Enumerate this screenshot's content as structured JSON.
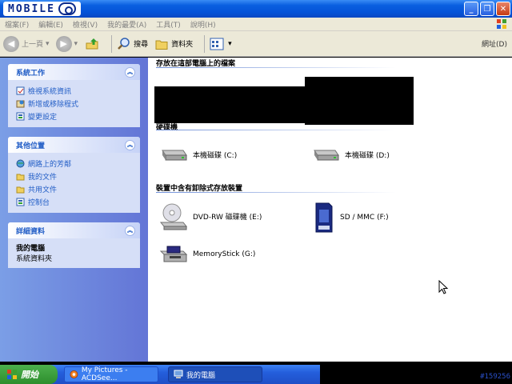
{
  "window": {
    "logo_text": "MOBILE"
  },
  "menu": [
    "檔案(F)",
    "編輯(E)",
    "檢視(V)",
    "我的最愛(A)",
    "工具(T)",
    "說明(H)"
  ],
  "toolbar": {
    "back_label": "上一頁",
    "search_label": "搜尋",
    "folders_label": "資料夾",
    "address_label": "網址(D)"
  },
  "left_panel": {
    "system_tasks": {
      "title": "系統工作",
      "items": [
        "檢視系統資訊",
        "新增或移除程式",
        "變更設定"
      ]
    },
    "other_places": {
      "title": "其他位置",
      "items": [
        "網路上的芳鄰",
        "我的文件",
        "共用文件",
        "控制台"
      ]
    },
    "details": {
      "title": "詳細資料",
      "name": "我的電腦",
      "sub": "系統資料夾"
    }
  },
  "main": {
    "section_files": "存放在這部電腦上的檔案",
    "section_hdd": "硬碟機",
    "drives": [
      {
        "label": "本機磁碟 (C:)",
        "icon": "hard-drive-icon"
      },
      {
        "label": "本機磁碟 (D:)",
        "icon": "hard-drive-icon"
      }
    ],
    "section_removable": "裝置中含有卸除式存放裝置",
    "removable": [
      {
        "label": "DVD-RW 磁碟機 (E:)",
        "icon": "dvd-drive-icon"
      },
      {
        "label": "SD / MMC (F:)",
        "icon": "sd-card-icon"
      },
      {
        "label": "MemoryStick (G:)",
        "icon": "memorystick-icon"
      }
    ]
  },
  "taskbar": {
    "start_label": "開始",
    "buttons": [
      "My Pictures - ACDSee...",
      "我的電腦"
    ],
    "tray_code": "#159256"
  }
}
